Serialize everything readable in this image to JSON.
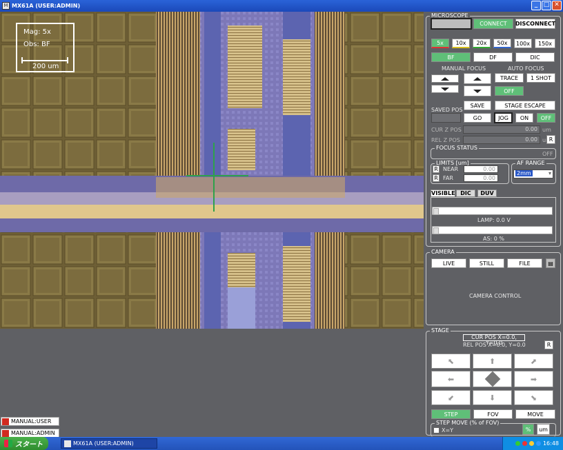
{
  "window": {
    "title": "MX61A (USER:ADMIN)",
    "icon": "app-icon"
  },
  "overlay": {
    "mag": "Mag: 5x",
    "obs": "Obs: BF",
    "scale": "200  um"
  },
  "manual_tabs": [
    "MANUAL:USER",
    "MANUAL:ADMIN"
  ],
  "microscope": {
    "title": "MICROSCOPE",
    "connect": "CONNECT",
    "disconnect": "DISCONNECT",
    "objectives": [
      "5x",
      "10x",
      "20x",
      "50x",
      "100x",
      "150x"
    ],
    "objective_selected": "5x",
    "obs_modes": [
      "BF",
      "DF",
      "DIC"
    ],
    "obs_selected": "BF",
    "manual_focus": "MANUAL FOCUS",
    "auto_focus": "AUTO FOCUS",
    "trace": "TRACE",
    "one_shot": "1 SHOT",
    "af_off": "OFF",
    "save": "SAVE",
    "stage_escape": "STAGE ESCAPE",
    "saved_pos": "SAVED POS",
    "go": "GO",
    "jog": "JOG",
    "on": "ON",
    "off": "OFF",
    "cur_z_pos": "CUR Z POS",
    "rel_z_pos": "REL Z POS",
    "cur_z_value": "0.00",
    "cur_z_unit": "um",
    "rel_z_value": "0.00",
    "rel_z_unit": "um",
    "reset": "R",
    "focus_status": "FOCUS STATUS",
    "focus_status_value": "OFF",
    "limits": "LIMITS [um]",
    "near": "NEAR",
    "far": "FAR",
    "near_value": "0.00",
    "far_value": "0.00",
    "limit_reset": "R",
    "af_range": "AF RANGE",
    "af_range_value": "2mm",
    "tabs": [
      "VISIBLE",
      "DIC",
      "DUV"
    ],
    "lamp": "LAMP: 0.0 V",
    "as": "AS:  0 %"
  },
  "camera": {
    "title": "CAMERA",
    "live": "LIVE",
    "still": "STILL",
    "file": "FILE",
    "control": "CAMERA CONTROL"
  },
  "stage": {
    "title": "STAGE",
    "cur_pos": "CUR POS X=0.0, Y=0.0",
    "rel_pos": "REL POS X=0.0, Y=0.0",
    "reset": "R",
    "modes": [
      "STEP",
      "FOV",
      "MOVE"
    ],
    "mode_selected": "STEP",
    "step_move": "STEP MOVE (% of FOV)",
    "xy": "X=Y",
    "percent": "%",
    "um": "um"
  },
  "taskbar": {
    "start": "スタート",
    "task": "MX61A (USER:ADMIN)",
    "clock": "16:48"
  }
}
